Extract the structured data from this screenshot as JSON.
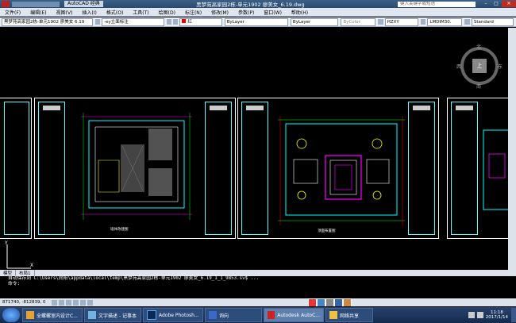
{
  "titlebar": {
    "workspace": "AutoCAD 经典",
    "title": "黑梦苑高家园2栋-单元1902 廖美女_6.19.dwg",
    "search_placeholder": "键入关键字或短语"
  },
  "menu": [
    "文件(F)",
    "编辑(E)",
    "视图(V)",
    "插入(I)",
    "格式(O)",
    "工具(T)",
    "绘图(D)",
    "标注(N)",
    "修改(M)",
    "参数(P)",
    "窗口(W)",
    "帮助(H)"
  ],
  "toolbar": {
    "file_tab": "黑梦苑高家园2栋-单元1902 廖美女 6.19",
    "layer": "-ey立面标注",
    "color": "红",
    "linetype": "ByLayer",
    "lineweight": "ByLayer",
    "plotstyle": "ByColor",
    "textstyle": "HZXY",
    "dimstyle": "LMDIM30.",
    "tablestyle": "Standard"
  },
  "viewcube": {
    "north": "北",
    "south": "南",
    "east": "东",
    "west": "西",
    "face": "上"
  },
  "sheets": [
    {
      "caption": "墙体改建图"
    },
    {
      "caption": "顶面布置图"
    }
  ],
  "tabs": [
    "模型",
    "布局1"
  ],
  "command": {
    "line1": "自动保存到 C:\\Users\\向阳\\appdata\\local\\temp\\黑梦苑高家园2栋-单元1902 廖美女_6.19_1_1_9853.sv$ ...",
    "prompt": "命令:"
  },
  "status": {
    "coords": "871740, -812839, 0"
  },
  "taskbar": {
    "items": [
      {
        "label": "全螺螺室内设计C..."
      },
      {
        "label": "文字描述 - 记事本"
      },
      {
        "label": "Adobe Photosh..."
      },
      {
        "label": "询向"
      },
      {
        "label": "Autodesk AutoC..."
      },
      {
        "label": "网络共享"
      }
    ],
    "time": "11:18",
    "date": "2017/1/14"
  }
}
